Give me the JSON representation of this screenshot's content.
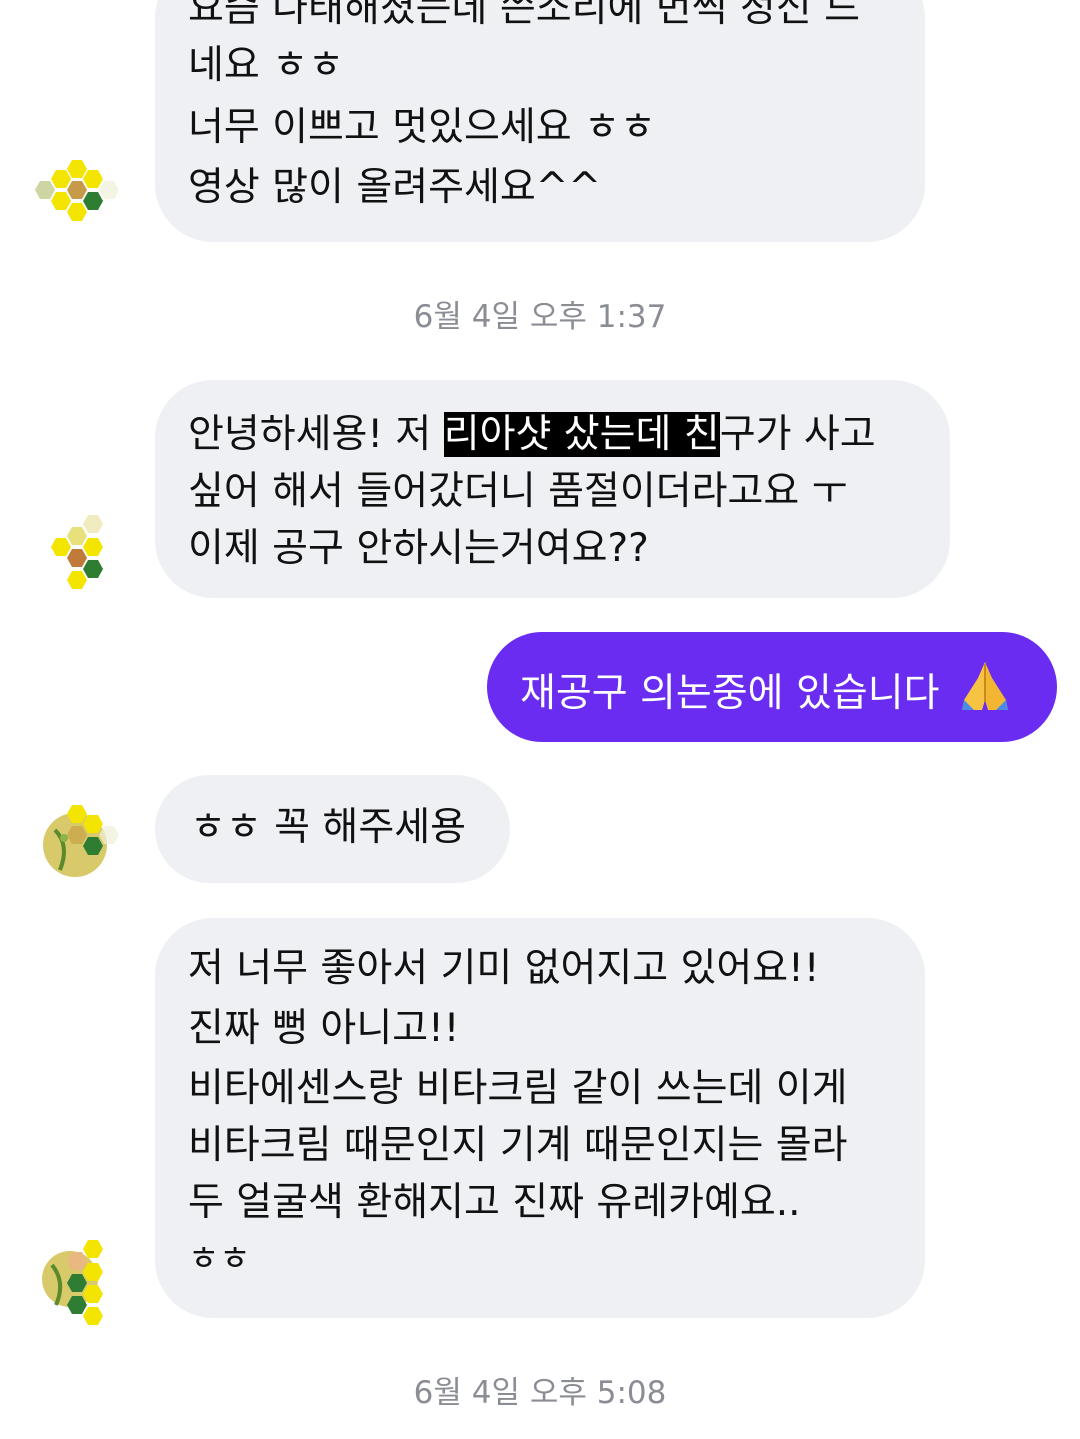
{
  "messages": {
    "msg1": {
      "lines": [
        "요즘 나태해졌는데 쓴소리에 번쩍 정신 드",
        "네요 ㅎㅎ",
        "너무 이쁘고 멋있으세요 ㅎㅎ",
        "영상 많이 올려주세요^^"
      ]
    },
    "ts1": "6월 4일 오후 1:37",
    "msg2": {
      "line1_pre": "안녕하세용! 저 ",
      "line1_hl": "리아샷 샀는데 친",
      "line1_post": "구가 사고",
      "line2": "싶어 해서 들어갔더니 품절이더라고요 ㅜ",
      "line3": "이제 공구 안하시는거여요??"
    },
    "reply": {
      "text": "재공구 의논중에 있습니다",
      "emoji": "folded-hands-icon"
    },
    "msg3": {
      "text": "ㅎㅎ 꼭 해주세용"
    },
    "msg4": {
      "lines": [
        "저 너무 좋아서 기미 없어지고 있어요!!",
        "진짜 뻥 아니고!!",
        "비타에센스랑 비타크림 같이 쓰는데 이게",
        "비타크림 때문인지 기계 때문인지는 몰라",
        "두 얼굴색 환해지고 진짜 유레카예요..",
        "ㅎㅎ"
      ]
    },
    "ts2": "6월 4일 오후 5:08"
  },
  "avatar": {
    "icon": "profile-avatar-icon",
    "colors": [
      "#f4e500",
      "#2e7d32",
      "#c79a4a"
    ]
  },
  "colors": {
    "incoming_bubble": "#eef0f4",
    "outgoing_bubble": "#6a2cf0",
    "timestamp": "#8a8d93"
  }
}
